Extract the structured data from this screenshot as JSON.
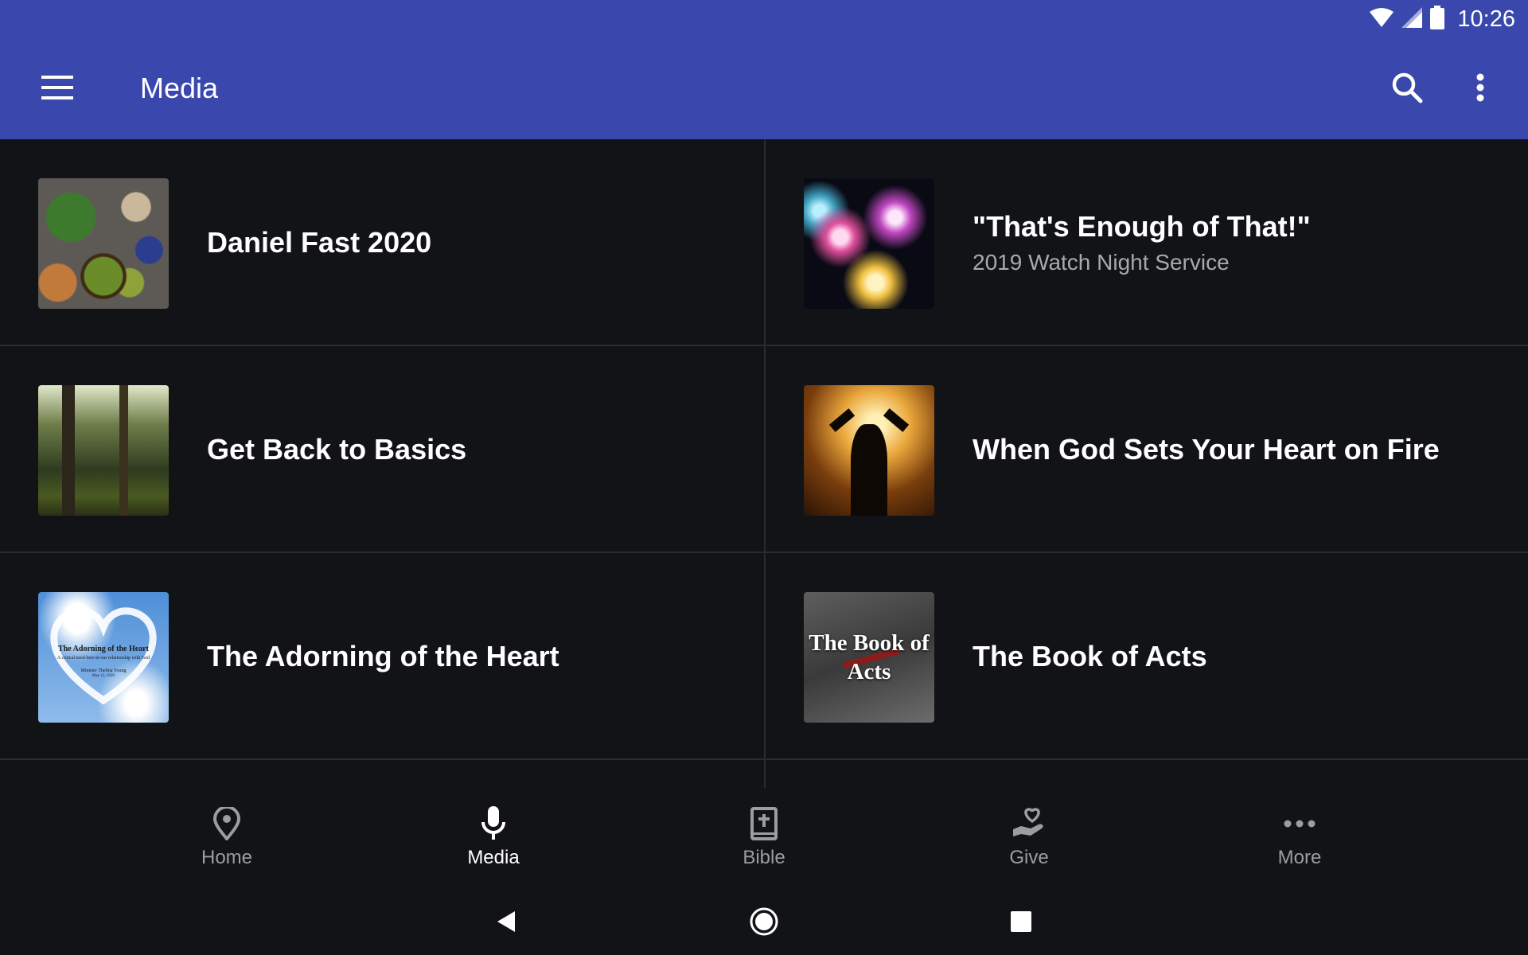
{
  "status_bar": {
    "time": "10:26"
  },
  "toolbar": {
    "title": "Media",
    "menu_icon": "hamburger-menu-icon",
    "search_icon": "search-icon",
    "more_icon": "more-vert-icon"
  },
  "media_items": [
    {
      "title": "Daniel Fast 2020",
      "subtitle": ""
    },
    {
      "title": "\"That's Enough of That!\"",
      "subtitle": "2019 Watch Night Service"
    },
    {
      "title": "Get Back to Basics",
      "subtitle": ""
    },
    {
      "title": "When God Sets Your Heart on Fire",
      "subtitle": ""
    },
    {
      "title": "The Adorning of the Heart",
      "subtitle": "",
      "thumb_text": {
        "title": "The Adorning of the Heart",
        "subtitle": "A critical need here in our relationship with God",
        "by": "Minister Thelma Young",
        "date": "May 12, 2020"
      }
    },
    {
      "title": "The Book of Acts",
      "subtitle": "",
      "thumb_text": {
        "line1": "The Book of",
        "line2": "Acts"
      }
    }
  ],
  "bottom_nav": [
    {
      "label": "Home",
      "icon": "location-pin-icon",
      "active": false
    },
    {
      "label": "Media",
      "icon": "microphone-icon",
      "active": true
    },
    {
      "label": "Bible",
      "icon": "bible-icon",
      "active": false
    },
    {
      "label": "Give",
      "icon": "give-hand-heart-icon",
      "active": false
    },
    {
      "label": "More",
      "icon": "more-horiz-icon",
      "active": false
    }
  ],
  "system_nav": {
    "back": "back-icon",
    "home": "home-circle-icon",
    "recents": "recents-square-icon"
  },
  "colors": {
    "app_bar": "#3a48ad",
    "background": "#121316",
    "divider": "#2a2c31",
    "inactive_label": "#9c9da1"
  }
}
